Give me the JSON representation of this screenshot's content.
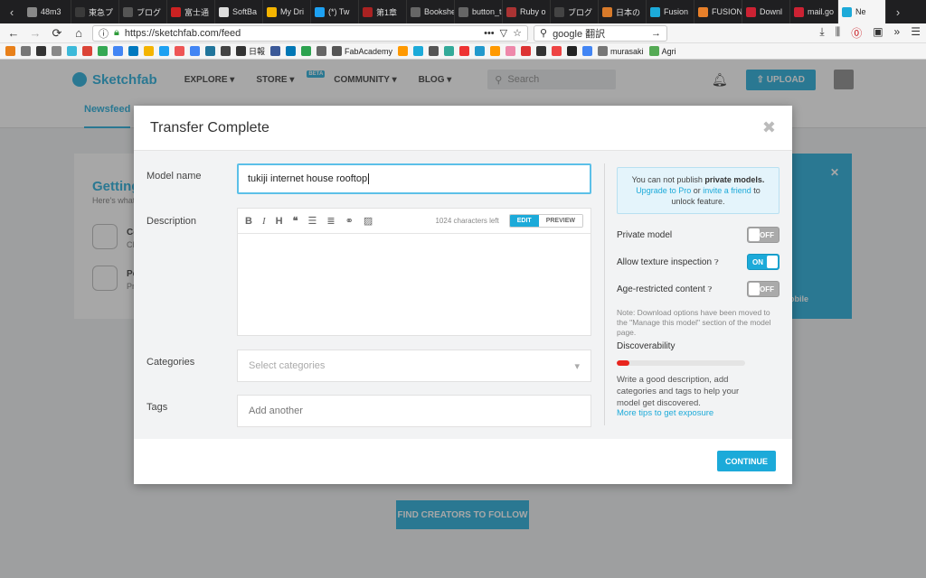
{
  "browser": {
    "tabs": [
      {
        "label": "48m3",
        "color": "#888888"
      },
      {
        "label": "東急プ",
        "color": "#3a3a3a"
      },
      {
        "label": "ブログ",
        "color": "#555555"
      },
      {
        "label": "富士通",
        "color": "#cc2222"
      },
      {
        "label": "SoftBa",
        "color": "#dddddd"
      },
      {
        "label": "My Dri",
        "color": "#f4b400"
      },
      {
        "label": "(*) Tw",
        "color": "#1da1f2"
      },
      {
        "label": "第1章",
        "color": "#aa2222"
      },
      {
        "label": "Bookshelf",
        "color": "#666666"
      },
      {
        "label": "button_to",
        "color": "#666666"
      },
      {
        "label": "Ruby o",
        "color": "#aa3333"
      },
      {
        "label": "ブログ",
        "color": "#444444"
      },
      {
        "label": "日本の",
        "color": "#d87a2a"
      },
      {
        "label": "Fusion",
        "color": "#1caad9"
      },
      {
        "label": "FUSION",
        "color": "#e8802a"
      },
      {
        "label": "Downl",
        "color": "#cc2233"
      },
      {
        "label": "mail.go",
        "color": "#cc2233"
      },
      {
        "label": "Ne",
        "color": "#1caad9"
      }
    ],
    "url": "https://sketchfab.com/feed",
    "search_value": "google 翻訳",
    "bookmarks": [
      "日報",
      "FabAcademy",
      "murasaki",
      "Agri"
    ]
  },
  "site": {
    "logo": "Sketchfab",
    "nav": [
      "EXPLORE",
      "STORE",
      "COMMUNITY",
      "BLOG"
    ],
    "beta": "BETA",
    "search_placeholder": "Search",
    "upload": "UPLOAD",
    "subnav_active": "Newsfeed",
    "getting_title": "Getting",
    "getting_sub": "Here's what",
    "card_row1": "Co",
    "card_row1b": "Cl",
    "card_row2": "Po",
    "card_row2b": "Pr",
    "panel_text": "obile",
    "follow_button": "FIND CREATORS TO FOLLOW"
  },
  "modal": {
    "title": "Transfer Complete",
    "labels": {
      "model_name": "Model name",
      "description": "Description",
      "categories": "Categories",
      "tags": "Tags"
    },
    "model_name_value": "tukiji internet house rooftop",
    "char_count": "1024 characters left",
    "edit": "EDIT",
    "preview": "PREVIEW",
    "categories_placeholder": "Select categories",
    "tags_placeholder": "Add another",
    "notice": {
      "pre": "You can not publish ",
      "bold": "private models.",
      "upgrade": "Upgrade to Pro",
      "or": " or ",
      "invite": "invite a friend",
      "post": " to unlock feature."
    },
    "options": [
      {
        "label": "Private model",
        "state": "OFF"
      },
      {
        "label": "Allow texture inspection",
        "state": "ON"
      },
      {
        "label": "Age-restricted content",
        "state": "OFF"
      }
    ],
    "note": "Note: Download options have been moved to the \"Manage this model\" section of the model page.",
    "discoverability_title": "Discoverability",
    "discoverability_level": 0.1,
    "discoverability_text": "Write a good description, add categories and tags to help your model get discovered.",
    "tips_link": "More tips to get exposure",
    "continue": "CONTINUE"
  },
  "colors": {
    "accent": "#1caad9",
    "discoverability_bar": "#e8251e"
  }
}
